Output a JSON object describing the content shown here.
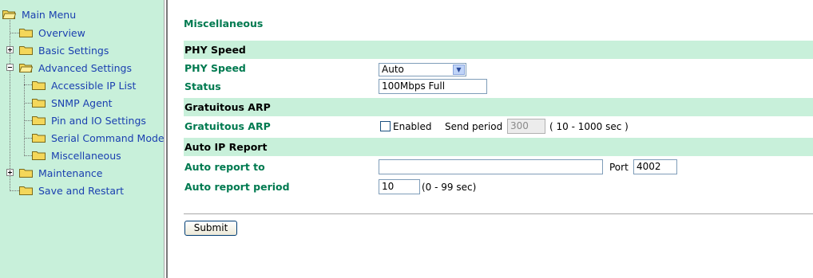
{
  "sidebar": {
    "main_menu": "Main Menu",
    "items": [
      {
        "label": "Overview"
      },
      {
        "label": "Basic Settings"
      },
      {
        "label": "Advanced Settings"
      },
      {
        "label": "Accessible IP List"
      },
      {
        "label": "SNMP Agent"
      },
      {
        "label": "Pin and IO Settings"
      },
      {
        "label": "Serial Command Mode"
      },
      {
        "label": "Miscellaneous"
      },
      {
        "label": "Maintenance"
      },
      {
        "label": "Save and Restart"
      }
    ]
  },
  "page": {
    "title": "Miscellaneous",
    "phy": {
      "section": "PHY Speed",
      "speed_label": "PHY Speed",
      "speed_value": "Auto",
      "status_label": "Status",
      "status_value": "100Mbps Full"
    },
    "arp": {
      "section": "Gratuitous ARP",
      "label": "Gratuitous ARP",
      "enabled_label": "Enabled",
      "enabled_checked": false,
      "send_period_label": "Send period",
      "send_period_value": "300",
      "range_text": "( 10 - 1000 sec )"
    },
    "auto_ip": {
      "section": "Auto IP Report",
      "report_to_label": "Auto report to",
      "report_to_value": "",
      "port_label": "Port",
      "port_value": "4002",
      "period_label": "Auto report period",
      "period_value": "10",
      "period_range": "(0 - 99 sec)"
    },
    "submit_label": "Submit"
  },
  "colors": {
    "sidebar_bg": "#c8f0da",
    "section_bg": "#c8f0da",
    "label_green": "#007a50",
    "link_blue": "#1a3fb0",
    "folder_yellow": "#f4d75a"
  }
}
